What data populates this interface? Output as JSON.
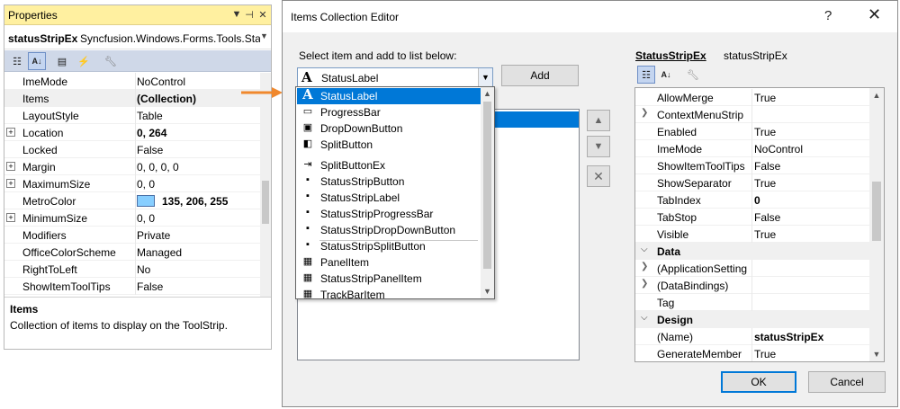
{
  "properties_panel": {
    "title": "Properties",
    "object_name": "statusStripEx",
    "object_type": "Syncfusion.Windows.Forms.Tools.Sta",
    "rows": [
      {
        "name": "ImeMode",
        "value": "NoControl",
        "expandable": false,
        "bold": false
      },
      {
        "name": "Items",
        "value": "(Collection)",
        "expandable": false,
        "bold": true
      },
      {
        "name": "LayoutStyle",
        "value": "Table",
        "expandable": false,
        "bold": false
      },
      {
        "name": "Location",
        "value": "0, 264",
        "expandable": true,
        "bold": true
      },
      {
        "name": "Locked",
        "value": "False",
        "expandable": false,
        "bold": false
      },
      {
        "name": "Margin",
        "value": "0, 0, 0, 0",
        "expandable": true,
        "bold": false
      },
      {
        "name": "MaximumSize",
        "value": "0, 0",
        "expandable": true,
        "bold": false
      },
      {
        "name": "MetroColor",
        "value": "135, 206, 255",
        "expandable": false,
        "bold": true
      },
      {
        "name": "MinimumSize",
        "value": "0, 0",
        "expandable": true,
        "bold": false
      },
      {
        "name": "Modifiers",
        "value": "Private",
        "expandable": false,
        "bold": false
      },
      {
        "name": "OfficeColorScheme",
        "value": "Managed",
        "expandable": false,
        "bold": false
      },
      {
        "name": "RightToLeft",
        "value": "No",
        "expandable": false,
        "bold": false
      },
      {
        "name": "ShowItemToolTips",
        "value": "False",
        "expandable": false,
        "bold": false
      }
    ],
    "description_title": "Items",
    "description_text": "Collection of items to display on the ToolStrip.",
    "metro_swatch_color": "#87ceff"
  },
  "dialog": {
    "title": "Items Collection Editor",
    "help_glyph": "?",
    "close_glyph": "✕",
    "select_label": "Select item and add to list below:",
    "combo_value": "StatusLabel",
    "add_button": "Add",
    "dropdown_items": [
      {
        "label": "StatusLabel",
        "icon": "A"
      },
      {
        "label": "ProgressBar",
        "icon": "▭"
      },
      {
        "label": "DropDownButton",
        "icon": "▣"
      },
      {
        "label": "SplitButton",
        "icon": "◧"
      },
      {
        "label": "SplitButtonEx",
        "icon": "⇥"
      },
      {
        "label": "StatusStripButton",
        "icon": "▪"
      },
      {
        "label": "StatusStripLabel",
        "icon": "▪"
      },
      {
        "label": "StatusStripProgressBar",
        "icon": "▪"
      },
      {
        "label": "StatusStripDropDownButton",
        "icon": "▪"
      },
      {
        "label": "StatusStripSplitButton",
        "icon": "▪"
      },
      {
        "label": "PanelItem",
        "icon": "▦"
      },
      {
        "label": "StatusStripPanelItem",
        "icon": "▦"
      },
      {
        "label": "TrackBarItem",
        "icon": "▦"
      }
    ],
    "right_object_name": "StatusStripEx",
    "right_object_type": "statusStripEx",
    "right_rows": [
      {
        "name": "AllowMerge",
        "value": "True",
        "kind": "prop"
      },
      {
        "name": "ContextMenuStrip",
        "value": "",
        "kind": "expand"
      },
      {
        "name": "Enabled",
        "value": "True",
        "kind": "prop"
      },
      {
        "name": "ImeMode",
        "value": "NoControl",
        "kind": "prop"
      },
      {
        "name": "ShowItemToolTips",
        "value": "False",
        "kind": "prop"
      },
      {
        "name": "ShowSeparator",
        "value": "True",
        "kind": "prop"
      },
      {
        "name": "TabIndex",
        "value": "0",
        "kind": "propbold"
      },
      {
        "name": "TabStop",
        "value": "False",
        "kind": "prop"
      },
      {
        "name": "Visible",
        "value": "True",
        "kind": "prop"
      },
      {
        "name": "Data",
        "value": "",
        "kind": "category"
      },
      {
        "name": "(ApplicationSetting",
        "value": "",
        "kind": "expand"
      },
      {
        "name": "(DataBindings)",
        "value": "",
        "kind": "expand"
      },
      {
        "name": "Tag",
        "value": "",
        "kind": "prop"
      },
      {
        "name": "Design",
        "value": "",
        "kind": "category"
      },
      {
        "name": "(Name)",
        "value": "statusStripEx",
        "kind": "propbold"
      },
      {
        "name": "GenerateMember",
        "value": "True",
        "kind": "prop"
      }
    ],
    "ok_button": "OK",
    "cancel_button": "Cancel"
  },
  "colors": {
    "accent": "#0078d7",
    "arrow": "#f0882d",
    "props_title_bg": "#fff0a0"
  }
}
